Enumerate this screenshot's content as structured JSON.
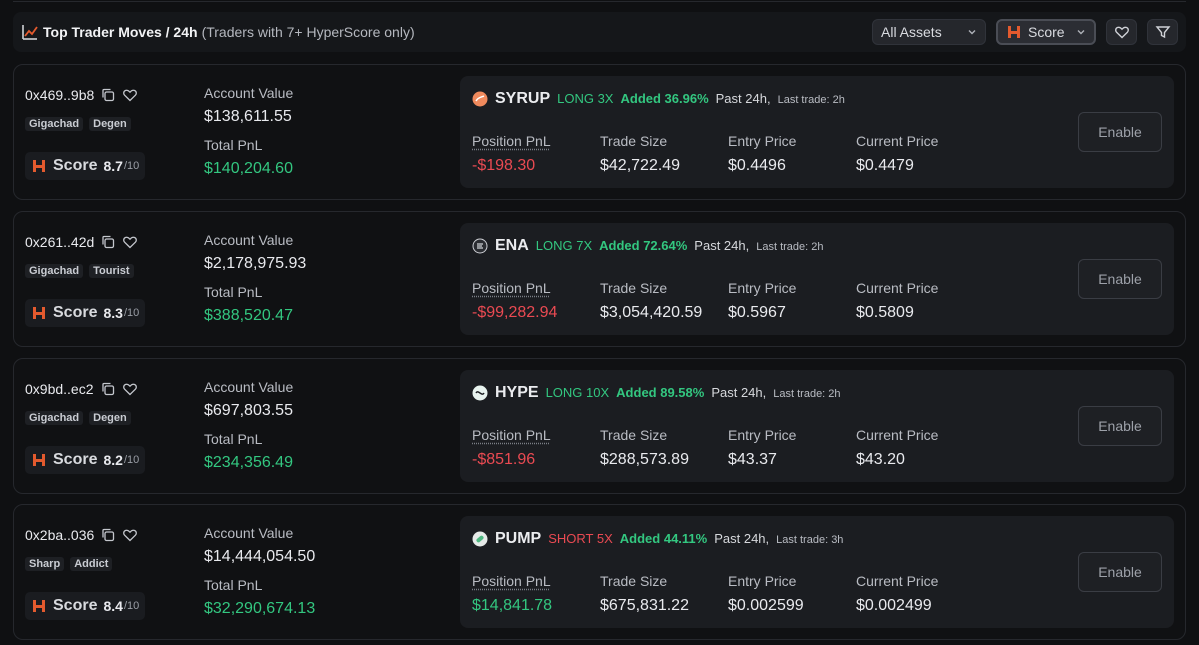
{
  "header": {
    "title": "Top Trader Moves / 24h",
    "subtitle": "(Traders with 7+ HyperScore only)",
    "assets_filter": "All Assets",
    "sort_select": "Score"
  },
  "colors": {
    "green": "#33c780",
    "red": "#ea4a52",
    "logo": "#e35a2e"
  },
  "traders": [
    {
      "address": "0x469..9b8",
      "tags": [
        "Gigachad",
        "Degen"
      ],
      "score_label": "Score",
      "score": "8.7",
      "score_max": "/10",
      "account_value_label": "Account Value",
      "account_value": "$138,611.55",
      "total_pnl_label": "Total PnL",
      "total_pnl": "$140,204.60",
      "position": {
        "symbol": "SYRUP",
        "coin_icon": "syrup-coin-icon",
        "direction": "LONG 3X",
        "added": "Added 36.96%",
        "past": "Past 24h,",
        "last_trade": "Last trade: 2h",
        "position_pnl_label": "Position PnL",
        "position_pnl": "-$198.30",
        "trade_size_label": "Trade Size",
        "trade_size": "$42,722.49",
        "entry_price_label": "Entry Price",
        "entry_price": "$0.4496",
        "current_price_label": "Current Price",
        "current_price": "$0.4479",
        "enable_label": "Enable"
      }
    },
    {
      "address": "0x261..42d",
      "tags": [
        "Gigachad",
        "Tourist"
      ],
      "score_label": "Score",
      "score": "8.3",
      "score_max": "/10",
      "account_value_label": "Account Value",
      "account_value": "$2,178,975.93",
      "total_pnl_label": "Total PnL",
      "total_pnl": "$388,520.47",
      "position": {
        "symbol": "ENA",
        "coin_icon": "ena-coin-icon",
        "direction": "LONG 7X",
        "added": "Added 72.64%",
        "past": "Past 24h,",
        "last_trade": "Last trade: 2h",
        "position_pnl_label": "Position PnL",
        "position_pnl": "-$99,282.94",
        "trade_size_label": "Trade Size",
        "trade_size": "$3,054,420.59",
        "entry_price_label": "Entry Price",
        "entry_price": "$0.5967",
        "current_price_label": "Current Price",
        "current_price": "$0.5809",
        "enable_label": "Enable"
      }
    },
    {
      "address": "0x9bd..ec2",
      "tags": [
        "Gigachad",
        "Degen"
      ],
      "score_label": "Score",
      "score": "8.2",
      "score_max": "/10",
      "account_value_label": "Account Value",
      "account_value": "$697,803.55",
      "total_pnl_label": "Total PnL",
      "total_pnl": "$234,356.49",
      "position": {
        "symbol": "HYPE",
        "coin_icon": "hype-coin-icon",
        "direction": "LONG 10X",
        "added": "Added 89.58%",
        "past": "Past 24h,",
        "last_trade": "Last trade: 2h",
        "position_pnl_label": "Position PnL",
        "position_pnl": "-$851.96",
        "trade_size_label": "Trade Size",
        "trade_size": "$288,573.89",
        "entry_price_label": "Entry Price",
        "entry_price": "$43.37",
        "current_price_label": "Current Price",
        "current_price": "$43.20",
        "enable_label": "Enable"
      }
    },
    {
      "address": "0x2ba..036",
      "tags": [
        "Sharp",
        "Addict"
      ],
      "score_label": "Score",
      "score": "8.4",
      "score_max": "/10",
      "account_value_label": "Account Value",
      "account_value": "$14,444,054.50",
      "total_pnl_label": "Total PnL",
      "total_pnl": "$32,290,674.13",
      "position": {
        "symbol": "PUMP",
        "coin_icon": "pump-coin-icon",
        "direction": "SHORT 5X",
        "added": "Added 44.11%",
        "past": "Past 24h,",
        "last_trade": "Last trade: 3h",
        "position_pnl_label": "Position PnL",
        "position_pnl": "$14,841.78",
        "trade_size_label": "Trade Size",
        "trade_size": "$675,831.22",
        "entry_price_label": "Entry Price",
        "entry_price": "$0.002599",
        "current_price_label": "Current Price",
        "current_price": "$0.002499",
        "enable_label": "Enable"
      }
    }
  ]
}
